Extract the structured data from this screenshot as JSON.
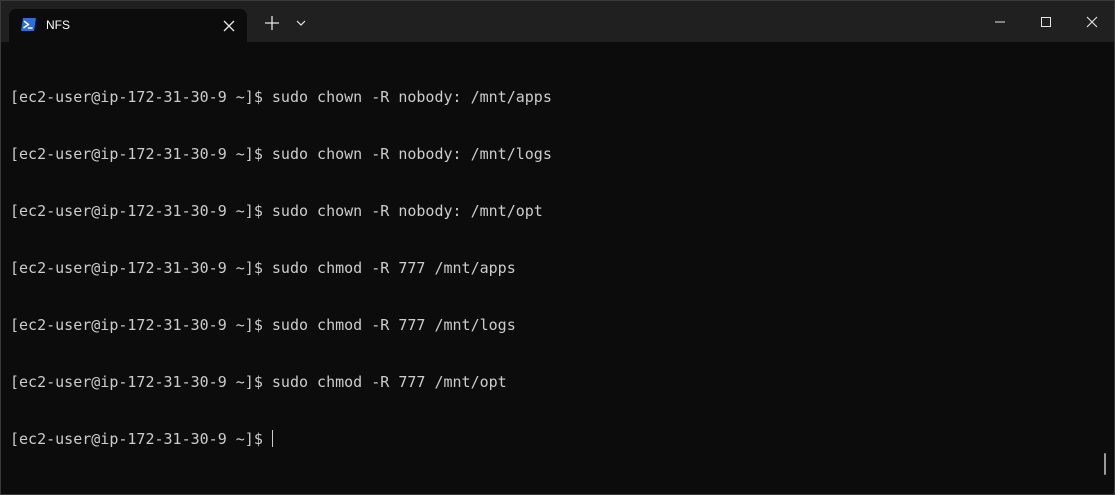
{
  "tab": {
    "title": "NFS",
    "icon": "powershell-icon"
  },
  "window_controls": [
    "new-tab-icon",
    "dropdown-icon",
    "minimize-icon",
    "maximize-icon",
    "close-icon"
  ],
  "terminal": {
    "lines": [
      "[ec2-user@ip-172-31-30-9 ~]$ sudo chown -R nobody: /mnt/apps",
      "[ec2-user@ip-172-31-30-9 ~]$ sudo chown -R nobody: /mnt/logs",
      "[ec2-user@ip-172-31-30-9 ~]$ sudo chown -R nobody: /mnt/opt",
      "[ec2-user@ip-172-31-30-9 ~]$ sudo chmod -R 777 /mnt/apps",
      "[ec2-user@ip-172-31-30-9 ~]$ sudo chmod -R 777 /mnt/logs",
      "[ec2-user@ip-172-31-30-9 ~]$ sudo chmod -R 777 /mnt/opt"
    ],
    "prompt": "[ec2-user@ip-172-31-30-9 ~]$"
  },
  "colors": {
    "background": "#0c0c0c",
    "titlebar": "#202020",
    "text": "#cccccc",
    "icon_blue": "#2a6fdb"
  }
}
